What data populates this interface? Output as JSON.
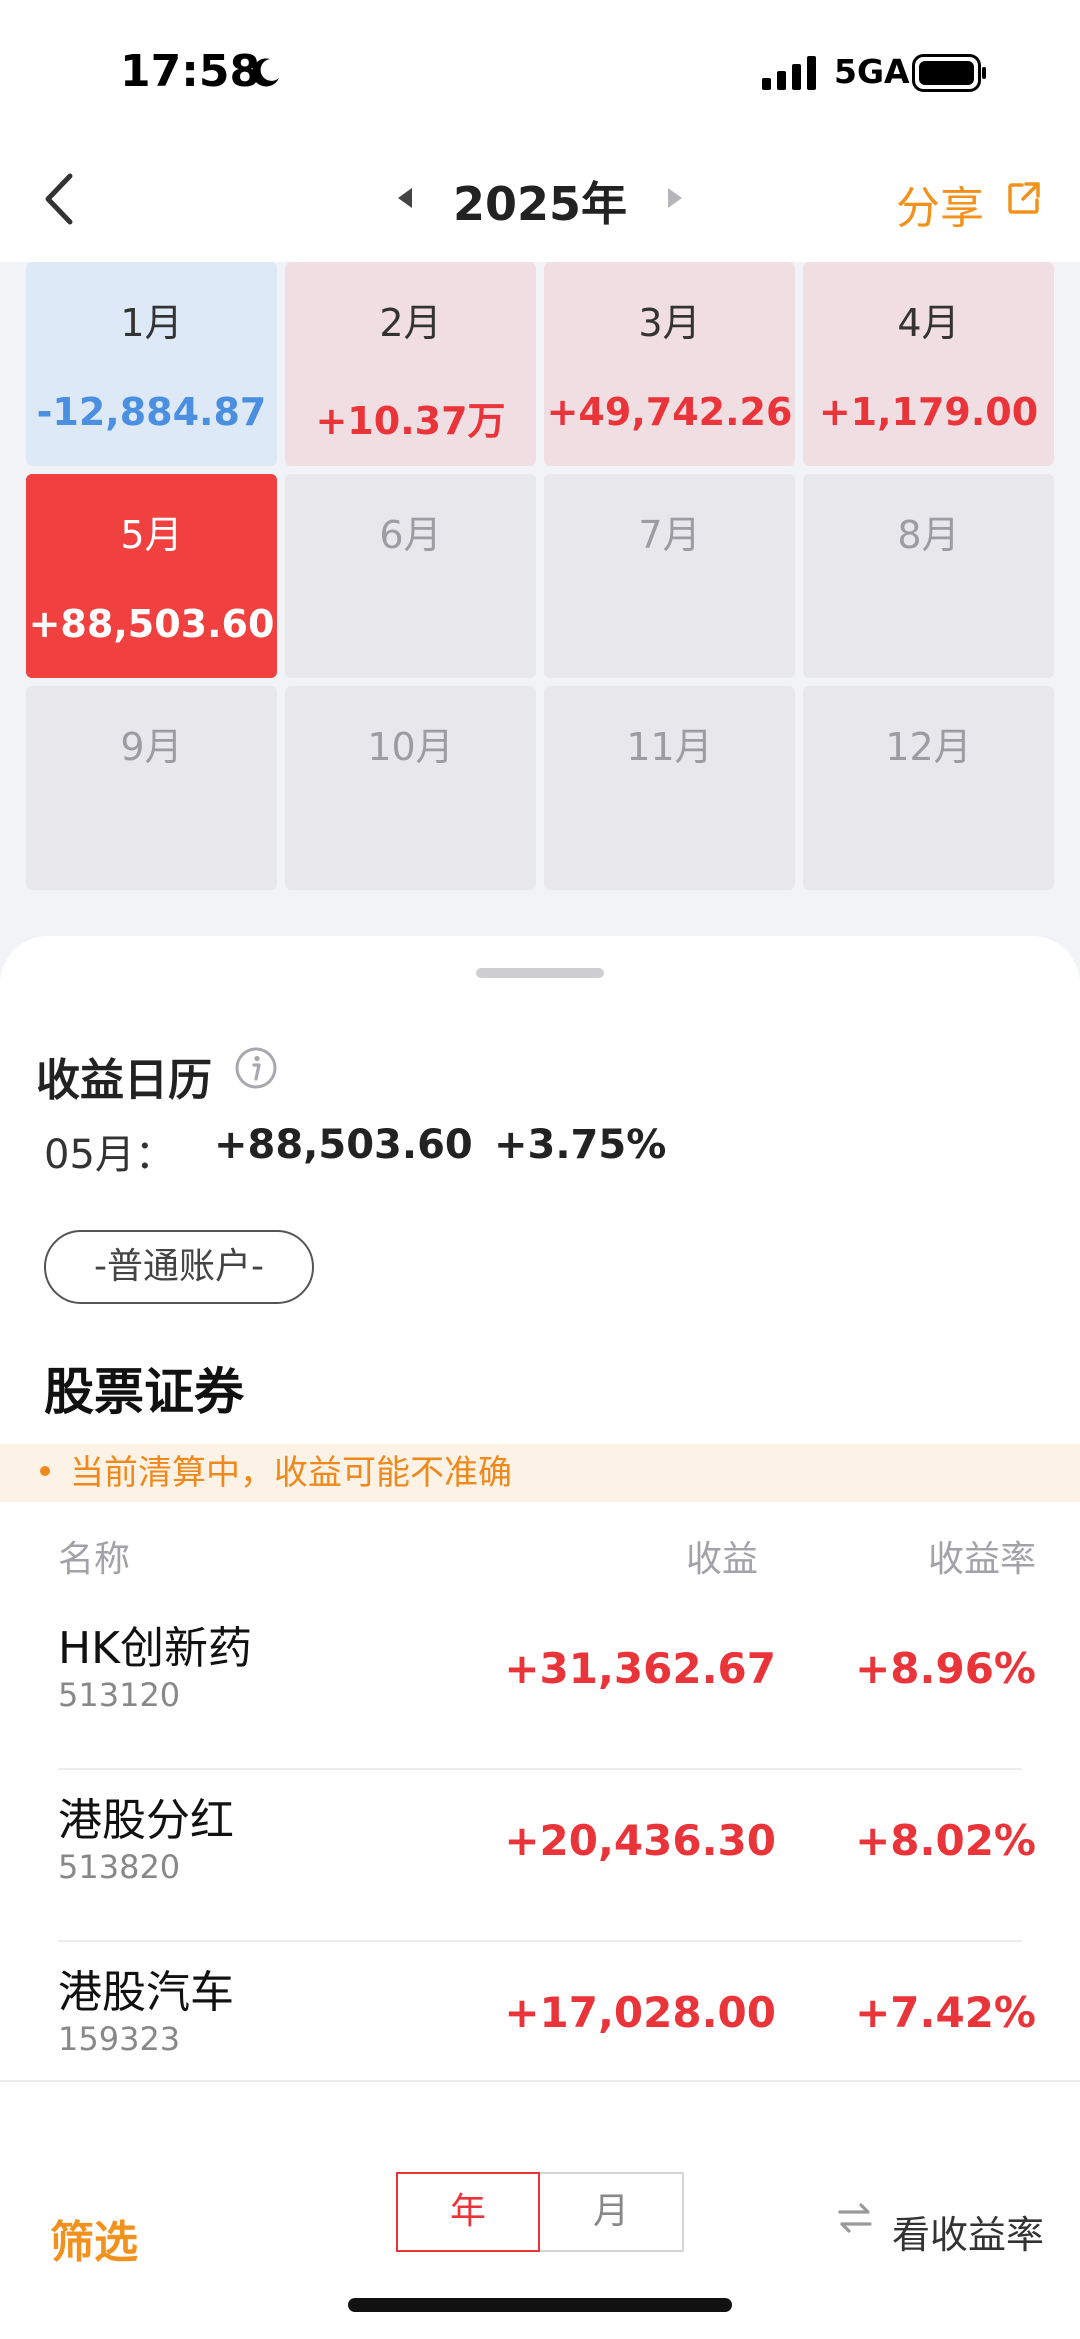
{
  "status_bar": {
    "time": "17:58",
    "network": "5GA"
  },
  "nav": {
    "year": "2025年",
    "share_label": "分享"
  },
  "months": [
    {
      "label": "1月",
      "value": "-12,884.87",
      "state": "loss"
    },
    {
      "label": "2月",
      "value": "+10.37万",
      "state": "gain"
    },
    {
      "label": "3月",
      "value": "+49,742.26",
      "state": "gain"
    },
    {
      "label": "4月",
      "value": "+1,179.00",
      "state": "gain"
    },
    {
      "label": "5月",
      "value": "+88,503.60",
      "state": "selected"
    },
    {
      "label": "6月",
      "value": "",
      "state": "empty"
    },
    {
      "label": "7月",
      "value": "",
      "state": "empty"
    },
    {
      "label": "8月",
      "value": "",
      "state": "empty"
    },
    {
      "label": "9月",
      "value": "",
      "state": "empty"
    },
    {
      "label": "10月",
      "value": "",
      "state": "empty"
    },
    {
      "label": "11月",
      "value": "",
      "state": "empty"
    },
    {
      "label": "12月",
      "value": "",
      "state": "empty"
    }
  ],
  "calendar": {
    "title": "收益日历",
    "month_label": "05月：",
    "amount": "+88,503.60",
    "rate": "+3.75%",
    "account": "-普通账户-"
  },
  "section": {
    "title": "股票证券",
    "notice": "当前清算中，收益可能不准确",
    "columns": {
      "name": "名称",
      "profit": "收益",
      "rate": "收益率"
    },
    "rows": [
      {
        "name": "HK创新药",
        "code": "513120",
        "profit": "+31,362.67",
        "rate": "+8.96%"
      },
      {
        "name": "港股分红",
        "code": "513820",
        "profit": "+20,436.30",
        "rate": "+8.02%"
      },
      {
        "name": "港股汽车",
        "code": "159323",
        "profit": "+17,028.00",
        "rate": "+7.42%"
      }
    ]
  },
  "toolbar": {
    "filter_label": "筛选",
    "year_label": "年",
    "month_label": "月",
    "view_rate_label": "看收益率"
  },
  "colors": {
    "accent_orange": "#f2921c",
    "gain_red": "#e9343a",
    "loss_blue": "#4a8fe0",
    "selected_red": "#f0403f"
  }
}
